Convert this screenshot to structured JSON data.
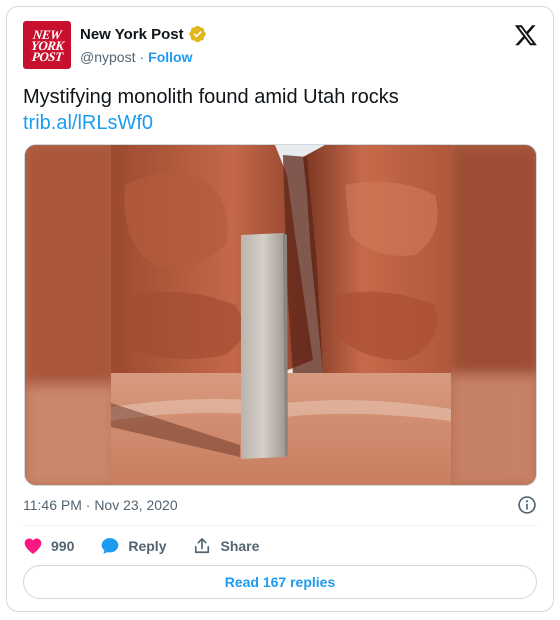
{
  "author": {
    "avatar_lines": [
      "NEW",
      "YORK",
      "POST"
    ],
    "name": "New York Post",
    "handle": "@nypost",
    "separator": "·",
    "follow_label": "Follow"
  },
  "tweet": {
    "text": "Mystifying monolith found amid Utah rocks",
    "link": "trib.al/lRLsWf0",
    "timestamp": "11:46 PM · Nov 23, 2020"
  },
  "actions": {
    "like_count": "990",
    "reply_label": "Reply",
    "share_label": "Share",
    "read_replies_label": "Read 167 replies"
  },
  "icons": {
    "platform": "x-logo-icon",
    "verified": "verified-badge-icon",
    "like": "heart-icon",
    "reply": "reply-bubble-icon",
    "share": "share-icon",
    "info": "info-icon"
  },
  "colors": {
    "accent": "#1d9bf0",
    "like": "#f91880",
    "verified_gold": "#e2b719",
    "brand_red": "#c8102e"
  }
}
